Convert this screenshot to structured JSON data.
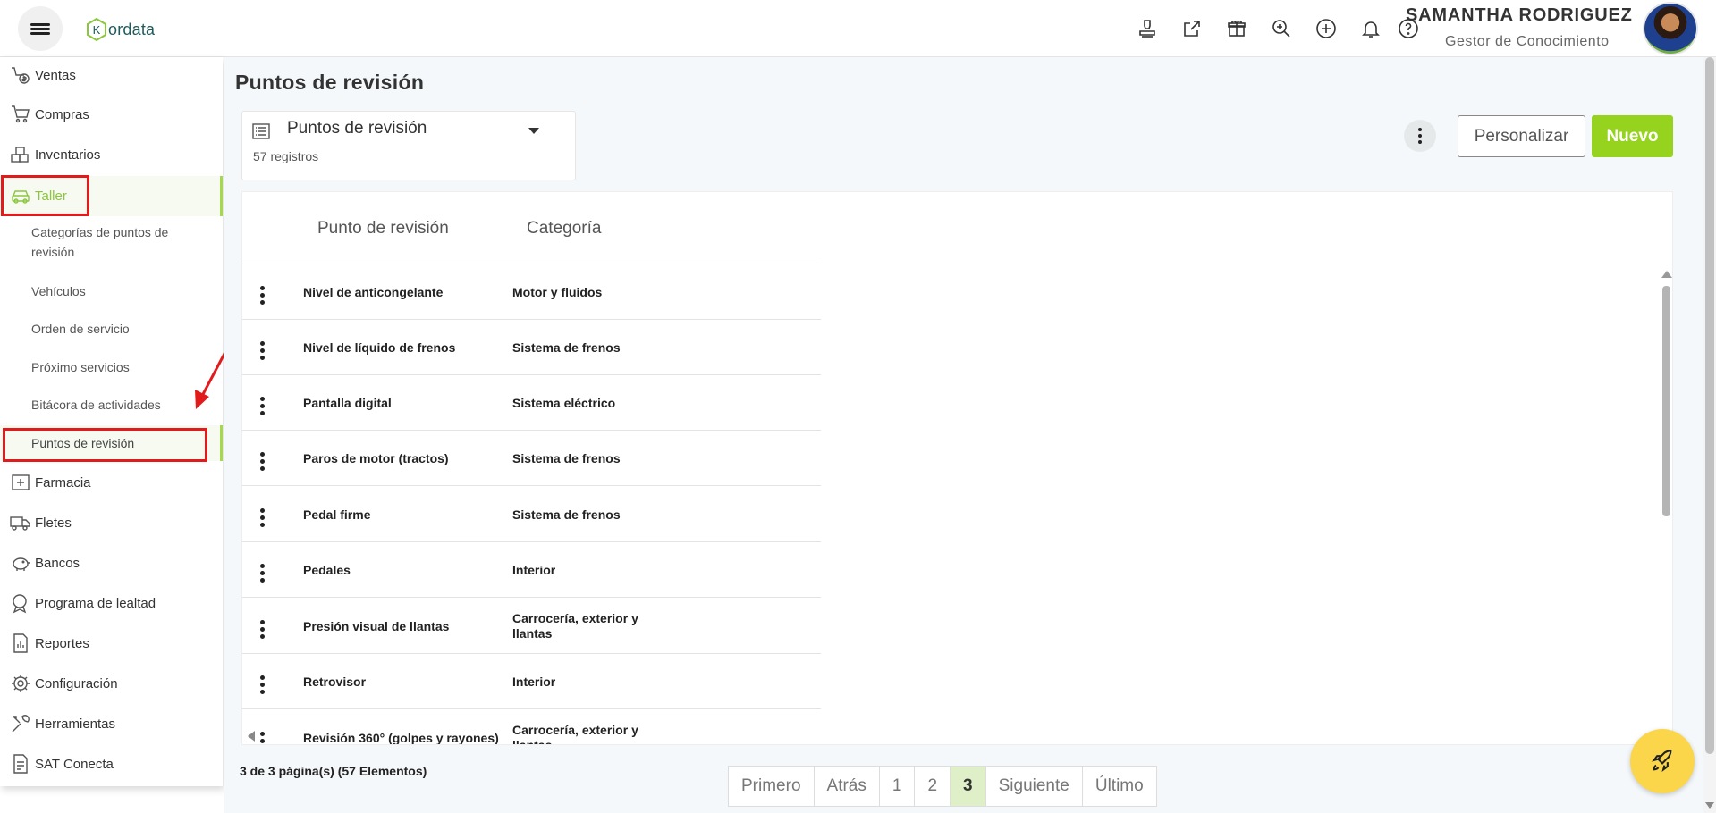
{
  "header": {
    "logo_text": "ordata",
    "logo_letter": "K",
    "user_name": "SAMANTHA RODRIGUEZ",
    "user_role": "Gestor de Conocimiento",
    "icons": [
      "stamp-icon",
      "external-link-icon",
      "gift-icon",
      "search-icon",
      "plus-circle-icon",
      "bell-icon",
      "help-icon"
    ]
  },
  "sidebar": {
    "items": [
      {
        "label": "Ventas",
        "icon": "sales-icon"
      },
      {
        "label": "Compras",
        "icon": "cart-icon"
      },
      {
        "label": "Inventarios",
        "icon": "boxes-icon"
      },
      {
        "label": "Taller",
        "icon": "car-icon"
      },
      {
        "label": "Farmacia",
        "icon": "pharmacy-icon"
      },
      {
        "label": "Fletes",
        "icon": "truck-icon"
      },
      {
        "label": "Bancos",
        "icon": "piggy-bank-icon"
      },
      {
        "label": "Programa de lealtad",
        "icon": "loyalty-icon"
      },
      {
        "label": "Reportes",
        "icon": "reports-icon"
      },
      {
        "label": "Configuración",
        "icon": "gear-icon"
      },
      {
        "label": "Herramientas",
        "icon": "tools-icon"
      },
      {
        "label": "SAT Conecta",
        "icon": "document-icon"
      }
    ],
    "taller_sub": [
      "Categorías de puntos de revisión",
      "Vehículos",
      "Orden de servicio",
      "Próximo servicios",
      "Bitácora de actividades",
      "Puntos de revisión"
    ]
  },
  "main": {
    "title": "Puntos de revisión",
    "view_name": "Puntos de revisión",
    "record_count": "57 registros",
    "customize_label": "Personalizar",
    "new_label": "Nuevo",
    "columns": [
      "Punto de revisión",
      "Categoría"
    ],
    "rows": [
      {
        "name": "Nivel de anticongelante",
        "category": "Motor y fluidos"
      },
      {
        "name": "Nivel de líquido de frenos",
        "category": "Sistema de frenos"
      },
      {
        "name": "Pantalla digital",
        "category": "Sistema eléctrico"
      },
      {
        "name": "Paros de motor (tractos)",
        "category": "Sistema de frenos"
      },
      {
        "name": "Pedal firme",
        "category": "Sistema de frenos"
      },
      {
        "name": "Pedales",
        "category": "Interior"
      },
      {
        "name": "Presión visual de llantas",
        "category": "Carrocería, exterior y llantas"
      },
      {
        "name": "Retrovisor",
        "category": "Interior"
      },
      {
        "name": "Revisión 360° (golpes y rayones)",
        "category": "Carrocería, exterior y llantas"
      }
    ],
    "page_info": "3 de 3 página(s) (57 Elementos)",
    "pagination": {
      "first": "Primero",
      "prev": "Atrás",
      "pages": [
        "1",
        "2",
        "3"
      ],
      "current": "3",
      "next": "Siguiente",
      "last": "Último"
    }
  },
  "colors": {
    "accent_green": "#95d31f",
    "annotation_red": "#e11b1b",
    "fab_yellow": "#fbd64b"
  }
}
